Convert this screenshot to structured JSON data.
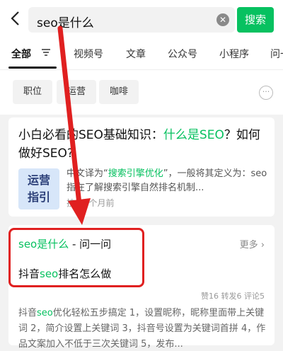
{
  "search": {
    "query": "seo是什么",
    "clear_icon": "clear-icon",
    "button_label": "搜索"
  },
  "tabs": [
    {
      "label": "全部",
      "active": true
    },
    {
      "label": "视频号"
    },
    {
      "label": "文章"
    },
    {
      "label": "公众号"
    },
    {
      "label": "小程序"
    },
    {
      "label": "问一"
    }
  ],
  "chips": [
    "职位",
    "运营",
    "咖啡"
  ],
  "result1": {
    "title_a": "小白必看的SEO基础知识：",
    "title_hl": "什么是SEO",
    "title_b": "？如何做好SEO?",
    "thumb_line1": "运营",
    "thumb_line2": "指引",
    "snippet_a": "中文译为“",
    "snippet_hl": "搜索引擎优化",
    "snippet_b": "”，一般将其定义为：seo指在了解搜索引擎自然排名机制...",
    "source": "技",
    "time": "3个月前"
  },
  "result2": {
    "head_hl": "seo是什么",
    "head_rest": " - 问一问",
    "more_label": "更多",
    "question_a": "抖音",
    "question_hl": "seo",
    "question_b": "排名怎么做",
    "stats": "赞16 转发6 评论5",
    "body_a": "抖音",
    "body_hl": "seo",
    "body_b": "优化轻松五步搞定 1，设置昵称，昵称里面带上关键词 2，简介设置上关键词 3，抖音号设置为关键词首拼 4，作品文案加入不低于三次关键词 5，发布..."
  },
  "colors": {
    "accent": "#07c160",
    "annotation": "#e02020"
  }
}
